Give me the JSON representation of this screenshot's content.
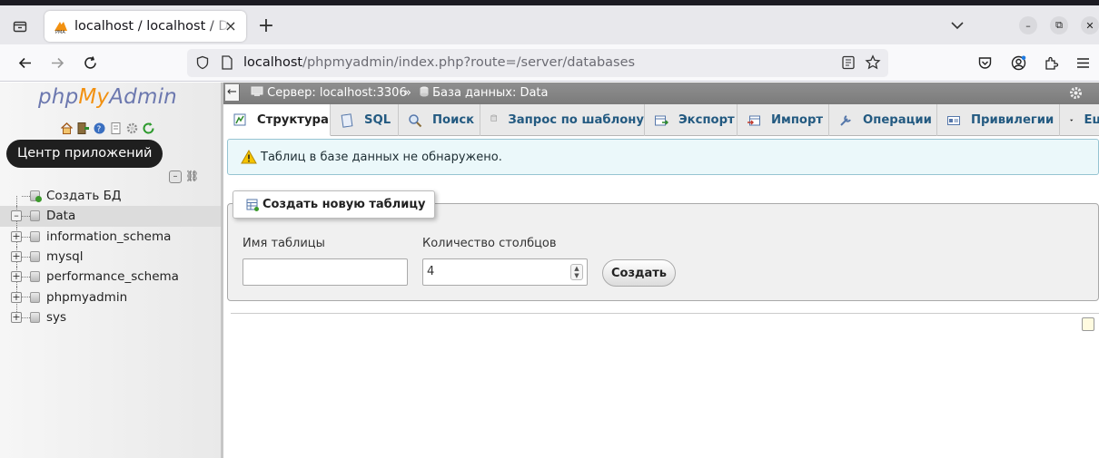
{
  "browser": {
    "tab_title": "localhost / localhost / Data",
    "tab_close": "×",
    "new_tab": "+",
    "url_host": "localhost",
    "url_path": "/phpmyadmin/index.php?route=/server/databases"
  },
  "pma": {
    "logo_php": "php",
    "logo_my": "My",
    "logo_admin": "Admin",
    "tooltip": "Центр приложений",
    "tree": [
      {
        "label": "Создать БД",
        "type": "new"
      },
      {
        "label": "Data",
        "type": "db",
        "expanded": true,
        "active": true
      },
      {
        "label": "information_schema",
        "type": "db"
      },
      {
        "label": "mysql",
        "type": "db"
      },
      {
        "label": "performance_schema",
        "type": "db"
      },
      {
        "label": "phpmyadmin",
        "type": "db"
      },
      {
        "label": "sys",
        "type": "db"
      }
    ]
  },
  "breadcrumb": {
    "collapse": "←",
    "server": "Сервер: localhost:3306",
    "separator": "»",
    "database": "База данных: Data"
  },
  "tabs": [
    {
      "label": "Структура",
      "icon": "structure-icon",
      "active": true
    },
    {
      "label": "SQL",
      "icon": "sql-icon"
    },
    {
      "label": "Поиск",
      "icon": "search-icon"
    },
    {
      "label": "Запрос по шаблону",
      "icon": "query-icon"
    },
    {
      "label": "Экспорт",
      "icon": "export-icon"
    },
    {
      "label": "Импорт",
      "icon": "import-icon"
    },
    {
      "label": "Операции",
      "icon": "operations-icon"
    },
    {
      "label": "Привилегии",
      "icon": "privileges-icon"
    },
    {
      "label": "Еще",
      "icon": "more-icon"
    }
  ],
  "notice": "Таблиц в базе данных не обнаружено.",
  "create_table": {
    "legend": "Создать новую таблицу",
    "name_label": "Имя таблицы",
    "name_value": "",
    "columns_label": "Количество столбцов",
    "columns_value": "4",
    "submit": "Создать"
  }
}
